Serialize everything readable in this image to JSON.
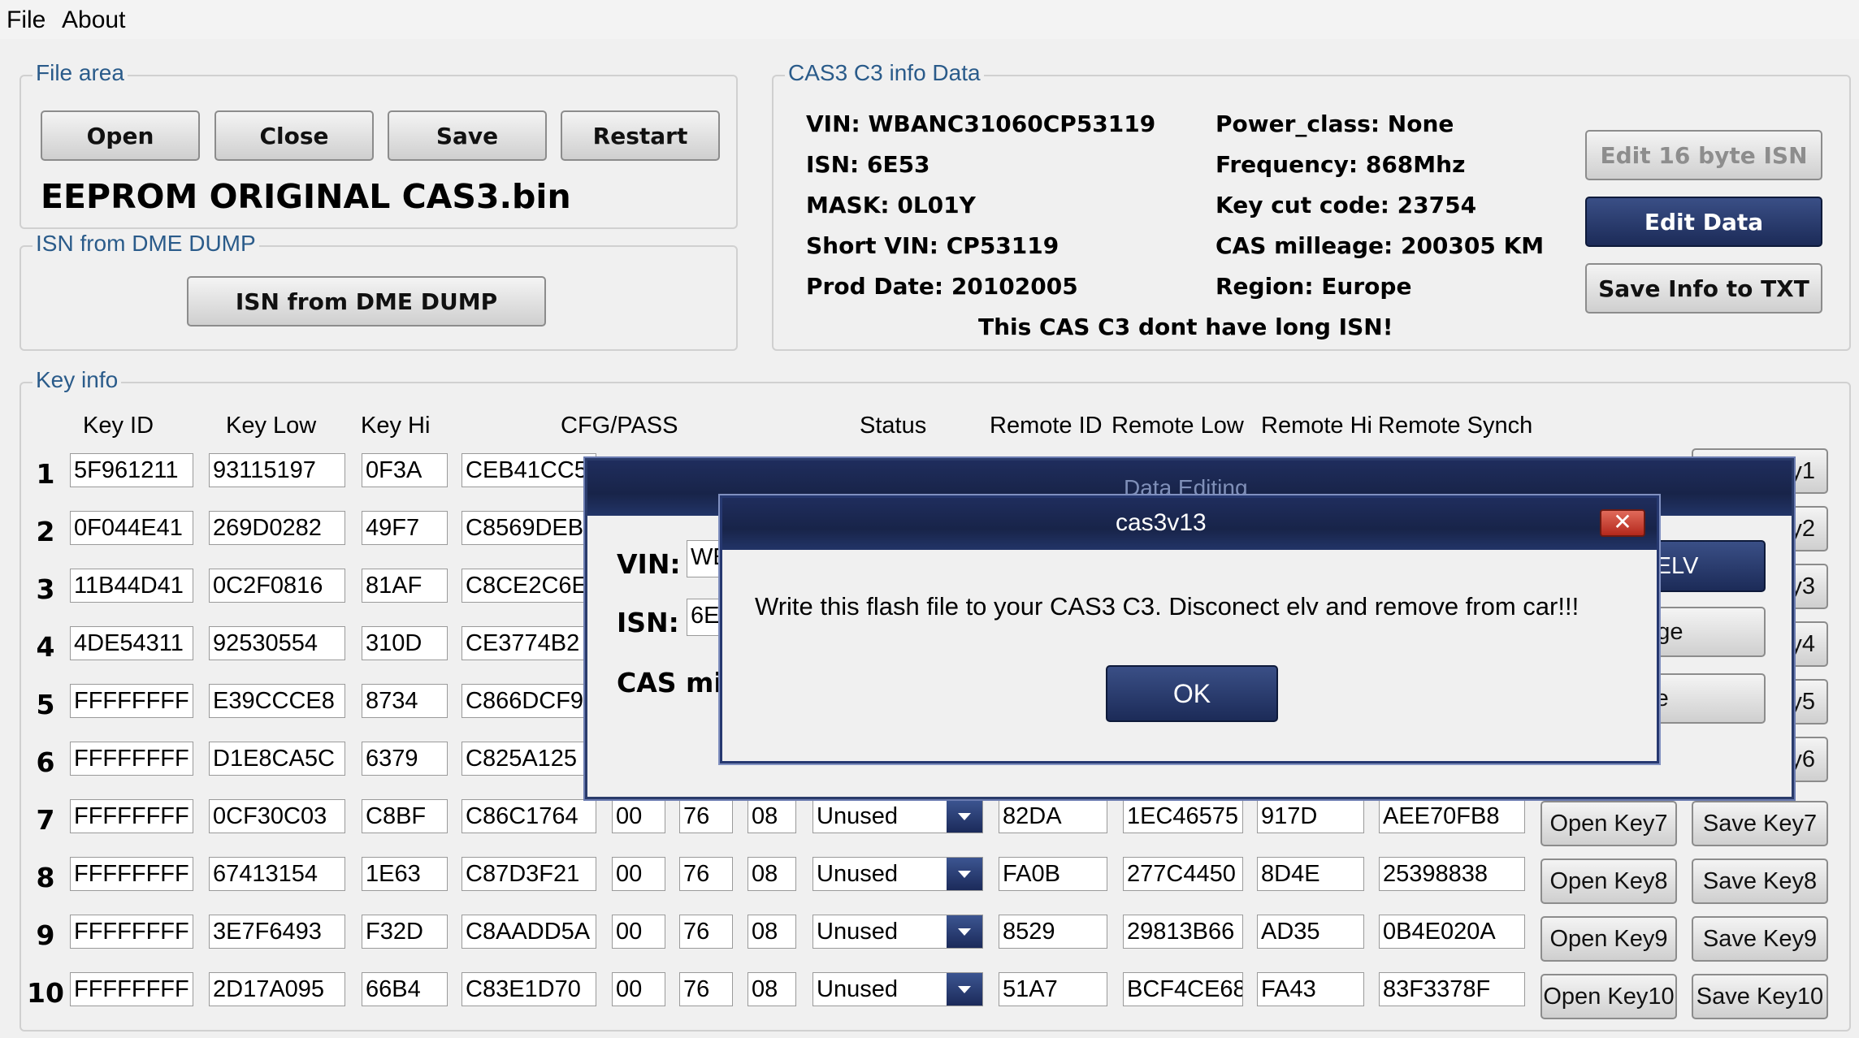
{
  "menu": {
    "file": "File",
    "about": "About"
  },
  "file_area": {
    "title": "File area",
    "open": "Open",
    "close": "Close",
    "save": "Save",
    "restart": "Restart",
    "filename": "EEPROM ORIGINAL CAS3.bin"
  },
  "isn_dump": {
    "title": "ISN from DME DUMP",
    "button": "ISN from DME DUMP"
  },
  "cas_info": {
    "title": "CAS3 C3 info Data",
    "vin": "VIN: WBANC31060CP53119",
    "isn": "ISN: 6E53",
    "mask": "MASK:  0L01Y",
    "short_vin": "Short VIN: CP53119",
    "prod_date": "Prod Date:  20102005",
    "power_class": "Power_class:  None",
    "frequency": "Frequency:  868Mhz",
    "key_cut": "Key cut code:  23754",
    "mileage": "CAS milleage:  200305 KM",
    "region": "Region:  Europe",
    "note": "This CAS C3 dont have long ISN!",
    "edit16": "Edit 16 byte ISN",
    "edit_data": "Edit Data",
    "save_txt": "Save Info to TXT"
  },
  "key_info": {
    "title": "Key info",
    "headers": {
      "key_id": "Key ID",
      "key_low": "Key Low",
      "key_hi": "Key Hi",
      "cfg": "CFG/PASS",
      "status": "Status",
      "remote_id": "Remote ID",
      "remote_low": "Remote Low",
      "remote_hi": "Remote Hi",
      "remote_synch": "Remote Synch"
    },
    "rows": [
      {
        "n": "1",
        "id": "5F961211",
        "low": "93115197",
        "hi": "0F3A",
        "cfg": "CEB41CC5",
        "side": "y1"
      },
      {
        "n": "2",
        "id": "0F044E41",
        "low": "269D0282",
        "hi": "49F7",
        "cfg": "C8569DEB",
        "side": "y2"
      },
      {
        "n": "3",
        "id": "11B44D41",
        "low": "0C2F0816",
        "hi": "81AF",
        "cfg": "C8CE2C6E",
        "side": "y3"
      },
      {
        "n": "4",
        "id": "4DE54311",
        "low": "92530554",
        "hi": "310D",
        "cfg": "CE3774B2",
        "side": "y4"
      },
      {
        "n": "5",
        "id": "FFFFFFFF",
        "low": "E39CCCE8",
        "hi": "8734",
        "cfg": "C866DCF9",
        "side": "y5"
      },
      {
        "n": "6",
        "id": "FFFFFFFF",
        "low": "D1E8CA5C",
        "hi": "6379",
        "cfg": "C825A125",
        "side": "y6"
      },
      {
        "n": "7",
        "id": "FFFFFFFF",
        "low": "0CF30C03",
        "hi": "C8BF",
        "cfg": "C86C1764",
        "p1": "00",
        "p2": "76",
        "p3": "08",
        "status": "Unused",
        "rid": "82DA",
        "rlow": "1EC46575",
        "rhi": "917D",
        "rsync": "AEE70FB8",
        "open": "Open Key7",
        "save": "Save Key7"
      },
      {
        "n": "8",
        "id": "FFFFFFFF",
        "low": "67413154",
        "hi": "1E63",
        "cfg": "C87D3F21",
        "p1": "00",
        "p2": "76",
        "p3": "08",
        "status": "Unused",
        "rid": "FA0B",
        "rlow": "277C4450",
        "rhi": "8D4E",
        "rsync": "25398838",
        "open": "Open Key8",
        "save": "Save Key8"
      },
      {
        "n": "9",
        "id": "FFFFFFFF",
        "low": "3E7F6493",
        "hi": "F32D",
        "cfg": "C8AADD5A",
        "p1": "00",
        "p2": "76",
        "p3": "08",
        "status": "Unused",
        "rid": "8529",
        "rlow": "29813B66",
        "rhi": "AD35",
        "rsync": "0B4E020A",
        "open": "Open Key9",
        "save": "Save Key9"
      },
      {
        "n": "10",
        "id": "FFFFFFFF",
        "low": "2D17A095",
        "hi": "66B4",
        "cfg": "C83E1D70",
        "p1": "00",
        "p2": "76",
        "p3": "08",
        "status": "Unused",
        "rid": "51A7",
        "rlow": "BCF4CE68",
        "rhi": "FA43",
        "rsync": "83F3378F",
        "open": "Open Key10",
        "save": "Save Key10"
      }
    ]
  },
  "data_editing": {
    "title": "Data Editing",
    "vin_label": "VIN:",
    "vin_value": "WE",
    "isn_label": "ISN:",
    "isn_value": "6E",
    "cas_label": "CAS mi",
    "elv_btn": "le ELV",
    "change_btn": "ange",
    "close_btn": "ose"
  },
  "message_box": {
    "title": "cas3v13",
    "text": "Write this flash file to your CAS3 C3. Disconect elv and remove from car!!!",
    "ok": "OK"
  }
}
